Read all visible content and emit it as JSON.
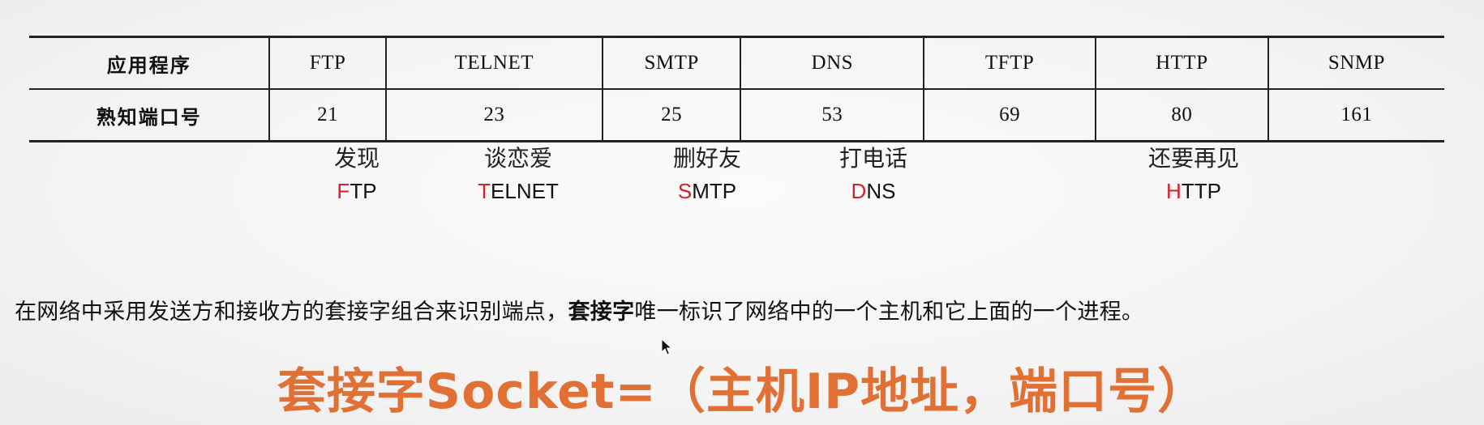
{
  "table": {
    "header_row": [
      "应用程序",
      "FTP",
      "TELNET",
      "SMTP",
      "DNS",
      "TFTP",
      "HTTP",
      "SNMP"
    ],
    "port_row": [
      "熟知端口号",
      "21",
      "23",
      "25",
      "53",
      "69",
      "80",
      "161"
    ]
  },
  "mnemonics": [
    {
      "zh": "发现",
      "acr_first": "F",
      "acr_rest": "TP"
    },
    {
      "zh": "谈恋爱",
      "acr_first": "T",
      "acr_rest": "ELNET"
    },
    {
      "zh": "删好友",
      "acr_first": "S",
      "acr_rest": "MTP"
    },
    {
      "zh": "打电话",
      "acr_first": "D",
      "acr_rest": "NS"
    },
    {
      "zh": "还要再见",
      "acr_first": "H",
      "acr_rest": "TTP"
    }
  ],
  "description": {
    "part1": "在网络中采用发送方和接收方的套接字组合来识别端点，",
    "bold": "套接字",
    "part2": "唯一标识了网络中的一个主机和它上面的一个进程。"
  },
  "formula": "套接字Socket=（主机IP地址，端口号）",
  "colors": {
    "highlight_letter": "#d4202a",
    "formula": "#e07034"
  },
  "icons": {
    "cursor": "mouse-pointer-icon"
  }
}
